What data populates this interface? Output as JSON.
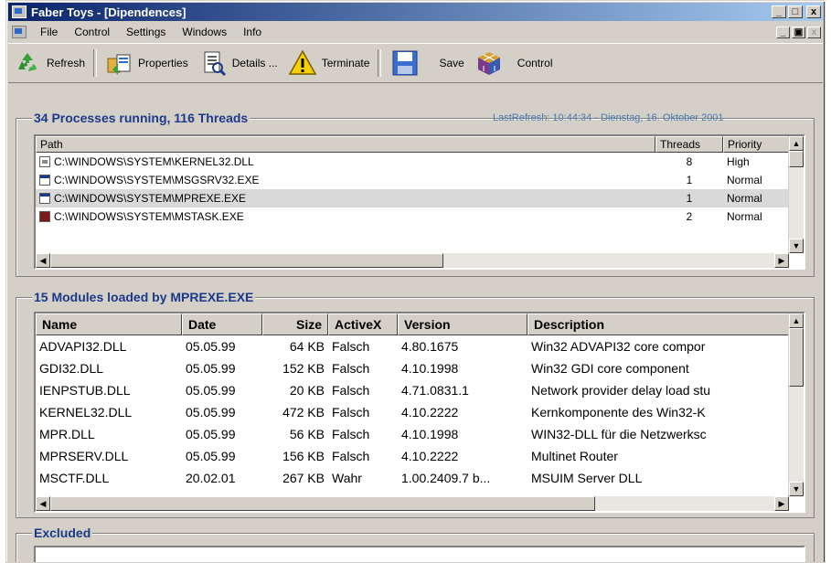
{
  "window": {
    "title": "Faber Toys - [Dipendences]",
    "caption": {
      "min": "_",
      "max": "□",
      "close": "x"
    },
    "mdi": {
      "min": "_",
      "restore": "▣",
      "close": "x"
    }
  },
  "menu": [
    "File",
    "Control",
    "Settings",
    "Windows",
    "Info"
  ],
  "toolbar": {
    "refresh": "Refresh",
    "properties": "Properties",
    "details": "Details ...",
    "terminate": "Terminate",
    "save": "Save",
    "control": "Control"
  },
  "processes": {
    "title": "34 Processes running, 116 Threads",
    "last_refresh": "LastRefresh: 10:44:34 - Dienstag, 16. Oktober 2001",
    "columns": [
      "Path",
      "Threads",
      "Priority"
    ],
    "rows": [
      {
        "path": "C:\\WINDOWS\\SYSTEM\\KERNEL32.DLL",
        "threads": "8",
        "priority": "High",
        "icon": "dll"
      },
      {
        "path": "C:\\WINDOWS\\SYSTEM\\MSGSRV32.EXE",
        "threads": "1",
        "priority": "Normal",
        "icon": "app"
      },
      {
        "path": "C:\\WINDOWS\\SYSTEM\\MPREXE.EXE",
        "threads": "1",
        "priority": "Normal",
        "icon": "app"
      },
      {
        "path": "C:\\WINDOWS\\SYSTEM\\MSTASK.EXE",
        "threads": "2",
        "priority": "Normal",
        "icon": "red"
      }
    ]
  },
  "modules": {
    "title": "15 Modules loaded by MPREXE.EXE",
    "columns": [
      "Name",
      "Date",
      "Size",
      "ActiveX",
      "Version",
      "Description"
    ],
    "rows": [
      [
        "ADVAPI32.DLL",
        "05.05.99",
        "64 KB",
        "Falsch",
        "4.80.1675",
        "Win32 ADVAPI32 core compor"
      ],
      [
        "GDI32.DLL",
        "05.05.99",
        "152 KB",
        "Falsch",
        "4.10.1998",
        "Win32 GDI core component"
      ],
      [
        "IENPSTUB.DLL",
        "05.05.99",
        "20 KB",
        "Falsch",
        "4.71.0831.1",
        "Network provider delay load stu"
      ],
      [
        "KERNEL32.DLL",
        "05.05.99",
        "472 KB",
        "Falsch",
        "4.10.2222",
        "Kernkomponente des Win32-K"
      ],
      [
        "MPR.DLL",
        "05.05.99",
        "56 KB",
        "Falsch",
        "4.10.1998",
        "WIN32-DLL für die Netzwerksc"
      ],
      [
        "MPRSERV.DLL",
        "05.05.99",
        "156 KB",
        "Falsch",
        "4.10.2222",
        "Multinet Router"
      ],
      [
        "MSCTF.DLL",
        "20.02.01",
        "267 KB",
        "Wahr",
        "1.00.2409.7 b...",
        "MSUIM Server DLL"
      ]
    ]
  },
  "excluded": {
    "title": "Excluded"
  }
}
